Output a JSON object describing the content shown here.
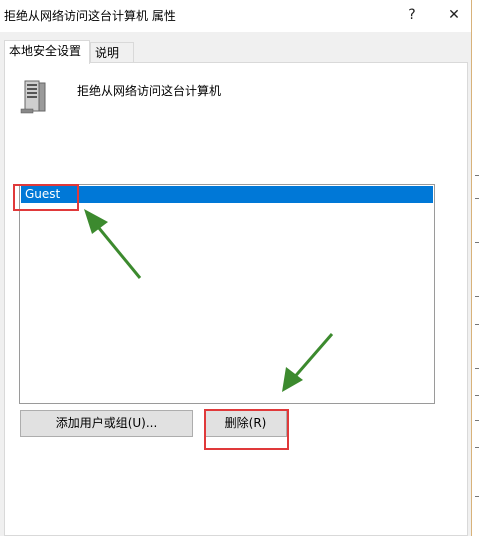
{
  "window": {
    "title": "拒绝从网络访问这台计算机 属性",
    "help_button": "?",
    "close_button": "✕"
  },
  "tabs": [
    {
      "label": "本地安全设置",
      "active": true
    },
    {
      "label": "说明",
      "active": false
    }
  ],
  "policy": {
    "title": "拒绝从网络访问这台计算机",
    "icon": "server-icon"
  },
  "users_list": {
    "items": [
      {
        "label": "Guest",
        "selected": true
      }
    ]
  },
  "buttons": {
    "add_label": "添加用户或组(U)...",
    "remove_label": "删除(R)"
  },
  "colors": {
    "selection": "#0078d7",
    "annotation_box": "#e0393a",
    "annotation_arrow": "#3c8a2e"
  }
}
